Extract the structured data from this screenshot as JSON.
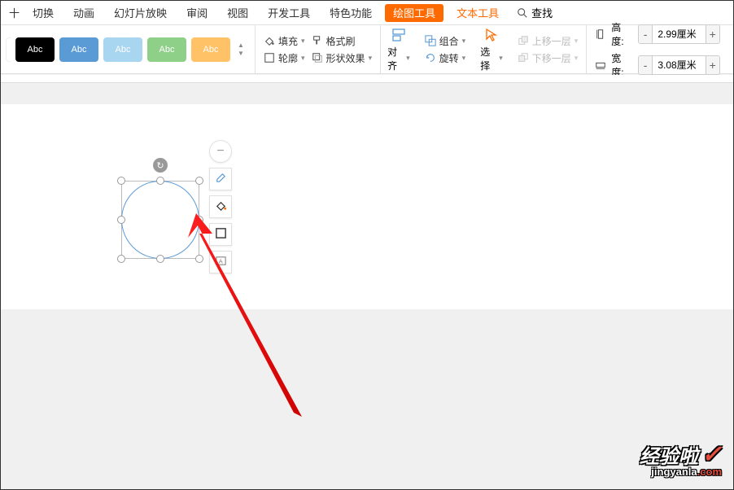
{
  "menu": {
    "items": [
      "切换",
      "动画",
      "幻灯片放映",
      "审阅",
      "视图",
      "开发工具",
      "特色功能"
    ],
    "active": "绘图工具",
    "text_tool": "文本工具",
    "search": "查找",
    "truncated_first": "十"
  },
  "styles": {
    "label": "Abc"
  },
  "fill_group": {
    "fill": "填充",
    "outline": "轮廓",
    "format_painter": "格式刷",
    "shape_effects": "形状效果"
  },
  "arrange": {
    "align": "对齐",
    "group": "组合",
    "rotate": "旋转",
    "select": "选择",
    "bring_forward": "上移一层",
    "send_backward": "下移一层"
  },
  "size": {
    "height_label": "高度:",
    "width_label": "宽度:",
    "height_value": "2.99厘米",
    "width_value": "3.08厘米",
    "minus": "-",
    "plus": "+"
  },
  "watermark": {
    "main": "经验啦",
    "sub_white": "jingyanla",
    "sub_red": ".com"
  }
}
